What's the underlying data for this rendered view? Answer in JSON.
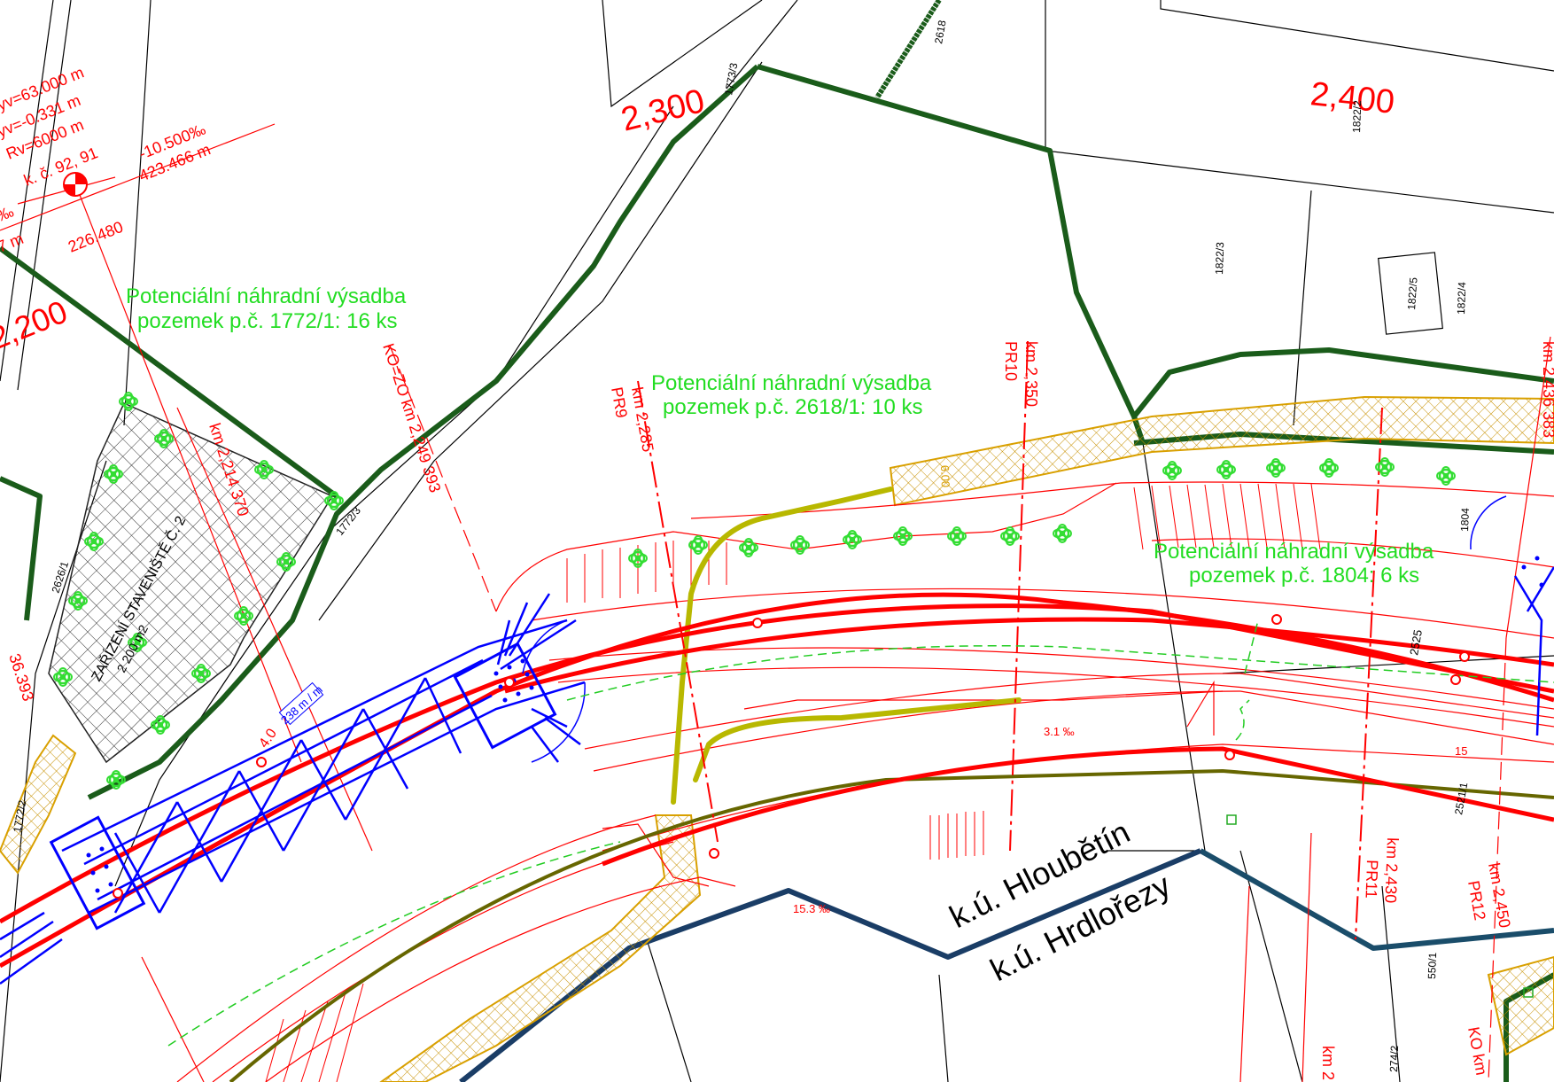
{
  "colors": {
    "alignment": "#ff0000",
    "green_boundary": "#1a5c1a",
    "planting_label": "#22dd22",
    "bridge": "#0000ff",
    "hatch_orange": "#d9a000",
    "path_olive": "#b8b800",
    "parcel_line": "#000000",
    "planting_symbol": "#33dd33"
  },
  "icons": {
    "tree_symbol": "tree-symbol-icon",
    "point_mark": "survey-point-icon",
    "curve_center": "curve-center-icon"
  },
  "chainage_labels": {
    "km_2200": "2,200",
    "km_2300": "2,300",
    "km_2400": "2,400"
  },
  "vertical_curve": {
    "line1": "yv=63.000 m",
    "line2": "yv=-0.331 m",
    "line3": "Rv=6000 m",
    "line4": "k. č. 92, 91",
    "line5": "‰",
    "line6": "7 m",
    "grade": "-10.500‰",
    "grade_length": "423.466 m",
    "station": "226.480"
  },
  "plantings": [
    {
      "line1": "Potenciální náhradní výsadba",
      "line2": "pozemek p.č. 1772/1: 16 ks"
    },
    {
      "line1": "Potenciální náhradní výsadba",
      "line2": "pozemek p.č. 2618/1: 10 ks"
    },
    {
      "line1": "Potenciální náhradní výsadba",
      "line2": "pozemek p.č. 1804: 6 ks"
    }
  ],
  "vertical_labels": {
    "ko_zo": "KO=ZO km 2,249 393",
    "km_2214": "km 2,214 370",
    "pr9_km": "km 2,285",
    "pr9": "PR9",
    "pr10_km": "km 2,350",
    "pr10": "PR10",
    "pr11_km": "km 2,430",
    "pr11": "PR11",
    "pr12_km": "km 2,450",
    "pr12": "PR12",
    "km_right_top": "km 2,436 383",
    "ko_km": "KO km",
    "km_bottom": "km 2",
    "km_left_edge": "36.393"
  },
  "site": {
    "label": "ZAŘÍZENÍ STAVENIŠTĚ Č. 2",
    "area": "2 200 m2"
  },
  "small_labels": {
    "bridge_length": "238 m / m",
    "bridge_station": "4.0",
    "slope_1": "3.1 ‰",
    "slope_2": "15.3 ‰",
    "slope_3": "15",
    "width": "6.00",
    "elev": "2525"
  },
  "parcels": {
    "p1772_3_a": "1773/3",
    "p1772_3_b": "1772/3",
    "p2618": "2618",
    "p1822_2": "1822/2",
    "p1822_3": "1822/3",
    "p1822_4": "1822/4",
    "p1822_5": "1822/5",
    "p1804": "1804",
    "p2626_1": "2626/1",
    "p1772_2": "1772/2",
    "p550_1": "550/1",
    "p274_2": "274/2",
    "p2521_1": "2521/1"
  },
  "cadastral": {
    "north": "k.ú. Hloubětín",
    "south": "k.ú. Hrdlořezy"
  }
}
